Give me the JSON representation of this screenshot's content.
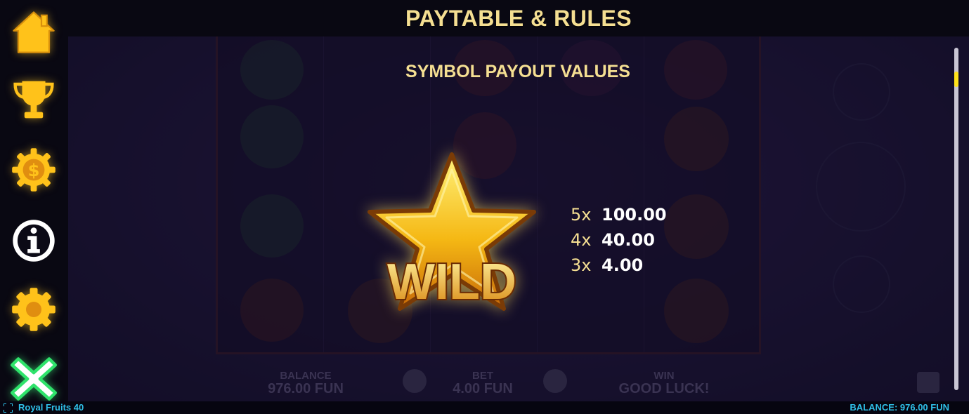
{
  "header": {
    "title": "PAYTABLE & RULES"
  },
  "menu": {
    "items": [
      {
        "name": "home-icon"
      },
      {
        "name": "trophy-icon"
      },
      {
        "name": "coin-gear-icon"
      },
      {
        "name": "info-icon"
      },
      {
        "name": "settings-icon"
      },
      {
        "name": "close-icon"
      }
    ]
  },
  "paytable": {
    "section_title": "SYMBOL PAYOUT VALUES",
    "symbol": {
      "name": "WILD",
      "icon": "wild-star-icon"
    },
    "payouts": [
      {
        "multiplier": "5x",
        "value": "100.00"
      },
      {
        "multiplier": "4x",
        "value": "40.00"
      },
      {
        "multiplier": "3x",
        "value": "4.00"
      }
    ]
  },
  "background_hud": {
    "balance_label": "BALANCE",
    "balance_value": "976.00 FUN",
    "bet_label": "BET",
    "bet_value": "4.00 FUN",
    "win_label": "WIN",
    "win_value": "GOOD LUCK!"
  },
  "statusbar": {
    "game_name": "Royal Fruits 40",
    "balance": "BALANCE: 976.00 FUN"
  },
  "colors": {
    "accent_gold": "#f5df92",
    "menu_gold": "#ffc21a",
    "status_cyan": "#2fc0e8",
    "close_green": "#2fe36b"
  }
}
